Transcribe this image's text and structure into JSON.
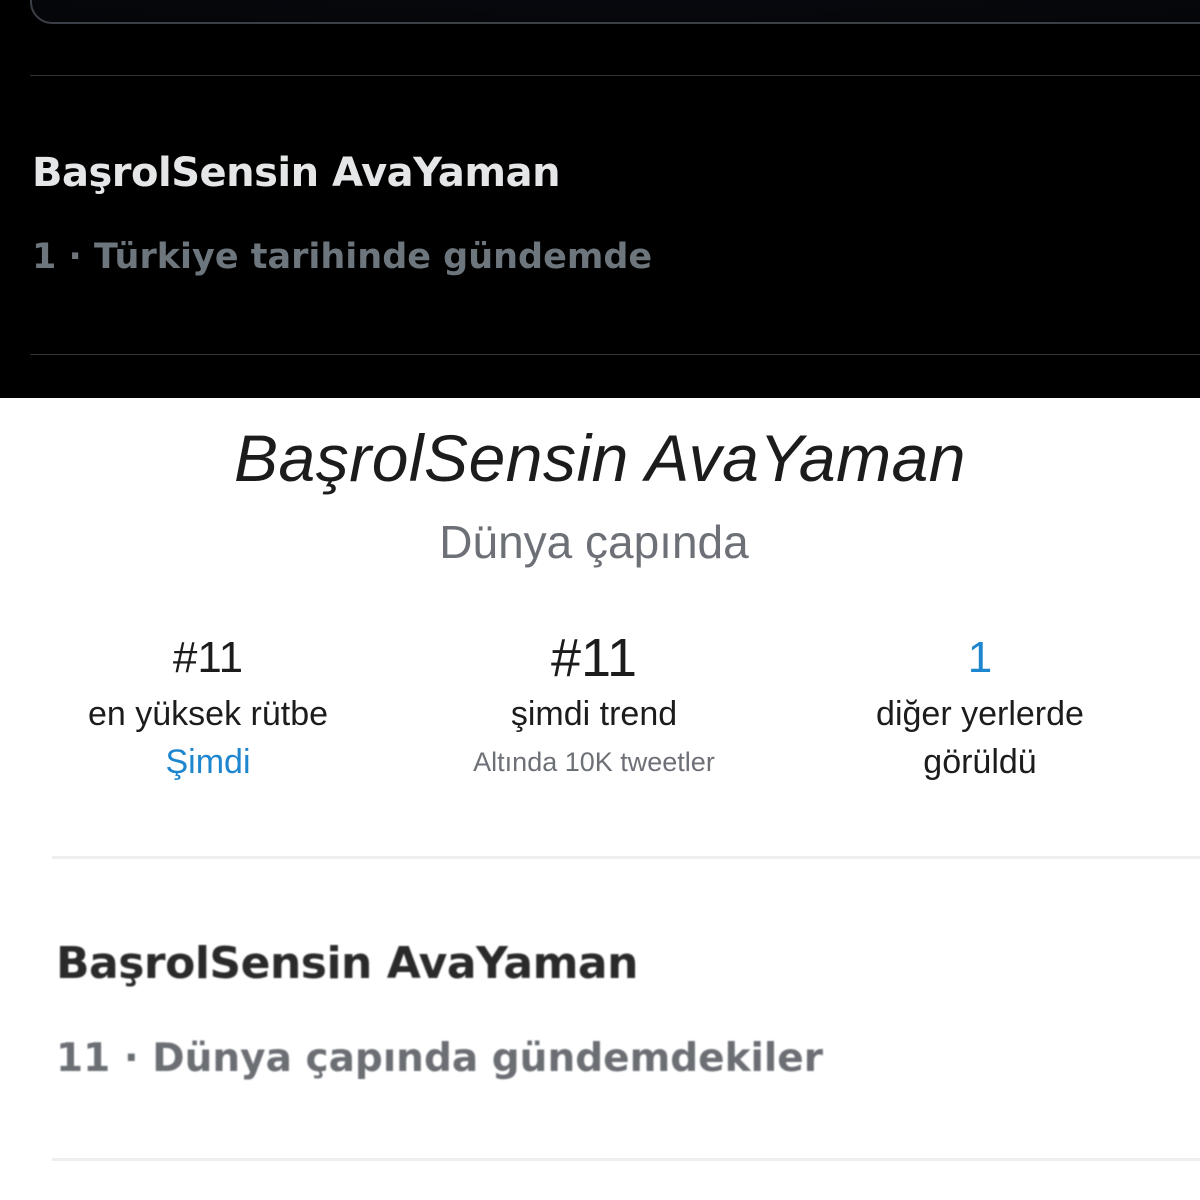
{
  "dark_card": {
    "trend_title": "BaşrolSensin AvaYaman",
    "trend_meta": "1 · Türkiye tarihinde gündemde"
  },
  "detail": {
    "title": "BaşrolSensin AvaYaman",
    "subtitle": "Dünya çapında",
    "stats": {
      "highest_rank": {
        "value": "#11",
        "label": "en yüksek rütbe",
        "sub": "Şimdi"
      },
      "trending_now": {
        "value": "#11",
        "label": "şimdi trend",
        "note": "Altında 10K tweetler"
      },
      "seen_elsewhere": {
        "value": "1",
        "label_line1": "diğer yerlerde",
        "label_line2": "görüldü"
      }
    }
  },
  "light_card": {
    "trend_title": "BaşrolSensin AvaYaman",
    "trend_meta": "11 · Dünya çapında gündemdekiler"
  },
  "colors": {
    "dark_bg": "#000000",
    "link_blue": "#1d86cf",
    "muted_gray": "#6d7177"
  }
}
